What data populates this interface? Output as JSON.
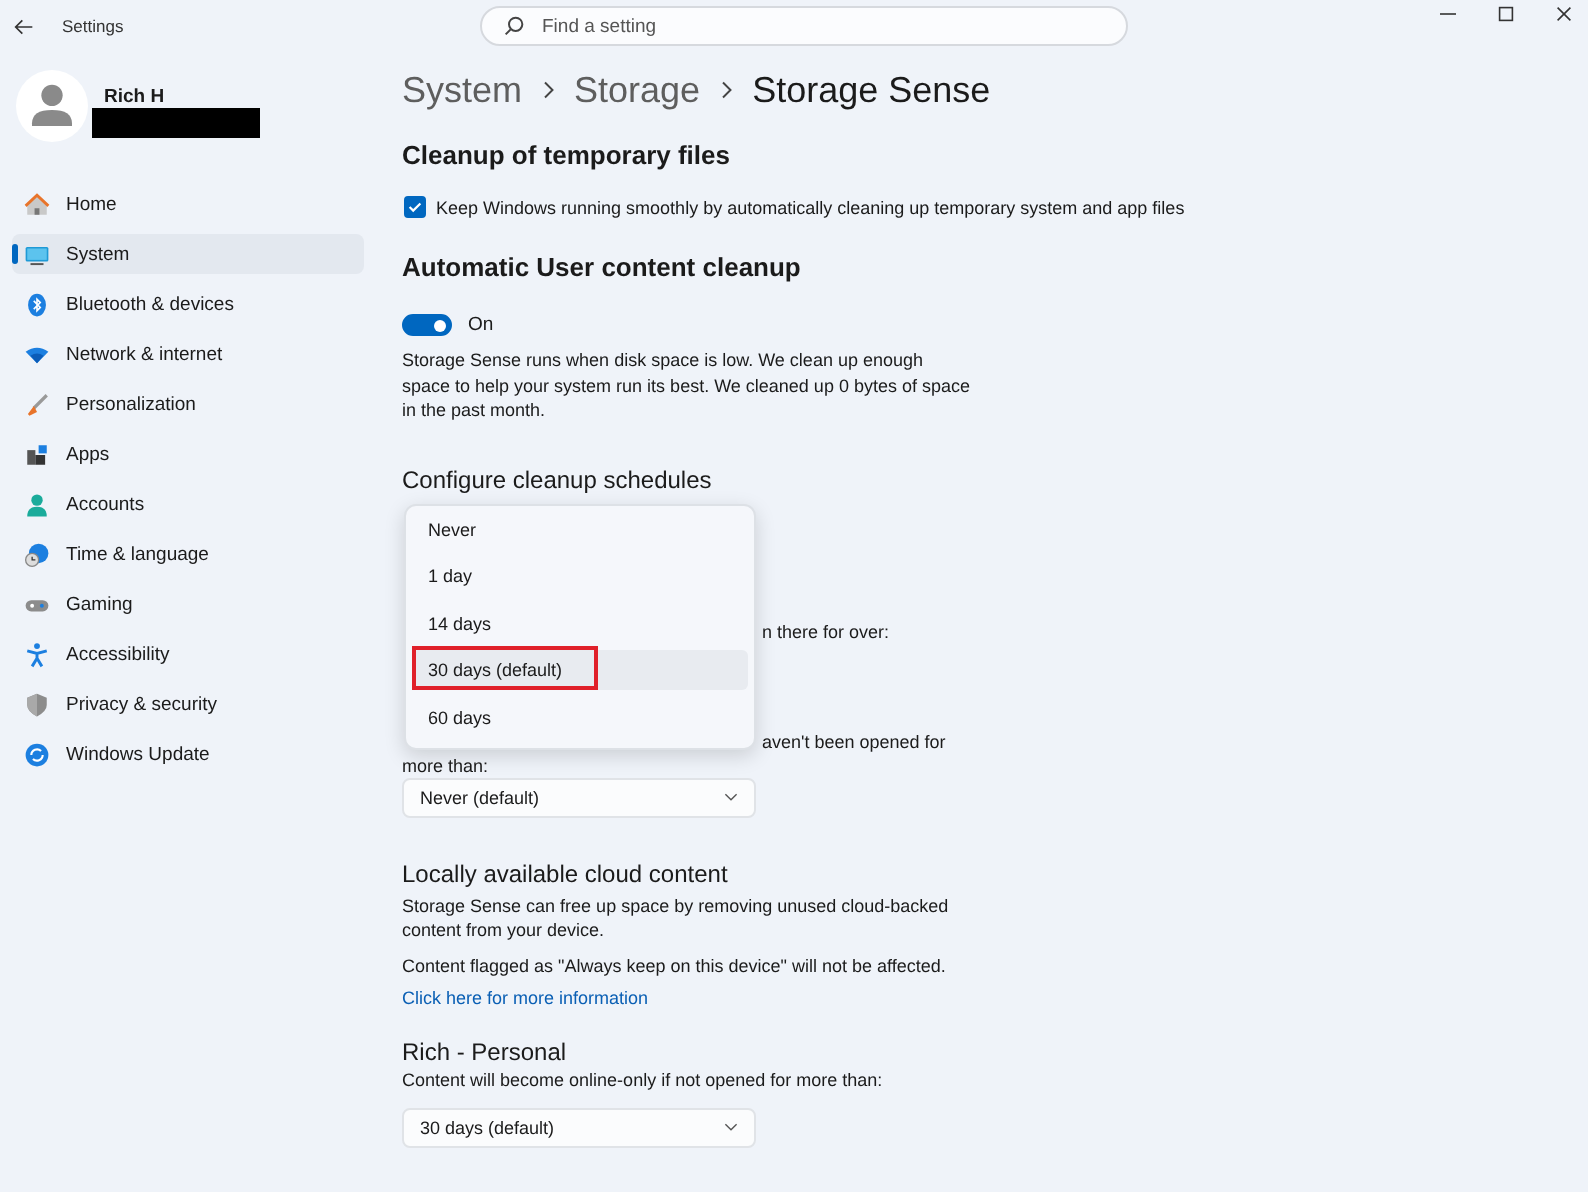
{
  "window": {
    "title": "Settings",
    "search": {
      "placeholder": "Find a setting"
    }
  },
  "account": {
    "name": "Rich H"
  },
  "sidebar": {
    "items": [
      {
        "label": "Home",
        "selected": false
      },
      {
        "label": "System",
        "selected": true
      },
      {
        "label": "Bluetooth & devices",
        "selected": false
      },
      {
        "label": "Network & internet",
        "selected": false
      },
      {
        "label": "Personalization",
        "selected": false
      },
      {
        "label": "Apps",
        "selected": false
      },
      {
        "label": "Accounts",
        "selected": false
      },
      {
        "label": "Time & language",
        "selected": false
      },
      {
        "label": "Gaming",
        "selected": false
      },
      {
        "label": "Accessibility",
        "selected": false
      },
      {
        "label": "Privacy & security",
        "selected": false
      },
      {
        "label": "Windows Update",
        "selected": false
      }
    ]
  },
  "breadcrumb": [
    "System",
    "Storage",
    "Storage Sense"
  ],
  "temp_files": {
    "heading": "Cleanup of temporary files",
    "checkbox": {
      "label": "Keep Windows running smoothly by automatically cleaning up temporary system and app files",
      "checked": true
    }
  },
  "user_content": {
    "heading": "Automatic User content cleanup",
    "toggle": {
      "label": "On",
      "on": true
    },
    "description": "Storage Sense runs when disk space is low. We clean up enough space to help your system run its best. We cleaned up 0 bytes of space in the past month."
  },
  "schedules": {
    "heading": "Configure cleanup schedules",
    "hidden_line_1": "n there for over:",
    "hidden_line_2": "aven't been opened for",
    "hidden_line_3": "more than:",
    "downloads_dropdown": "Never (default)"
  },
  "dropdown_menu": {
    "options": [
      {
        "label": "Never",
        "selected": false
      },
      {
        "label": "1 day",
        "selected": false
      },
      {
        "label": "14 days",
        "selected": false
      },
      {
        "label": "30 days (default)",
        "selected": true,
        "highlighted": true
      },
      {
        "label": "60 days",
        "selected": false
      }
    ]
  },
  "cloud": {
    "heading": "Locally available cloud content",
    "description": "Storage Sense can free up space by removing unused cloud-backed content from your device.",
    "note": "Content flagged as \"Always keep on this device\" will not be affected.",
    "link": "Click here for more information",
    "account_heading": "Rich - Personal",
    "account_text": "Content will become online-only if not opened for more than:",
    "dropdown": "30 days (default)"
  }
}
